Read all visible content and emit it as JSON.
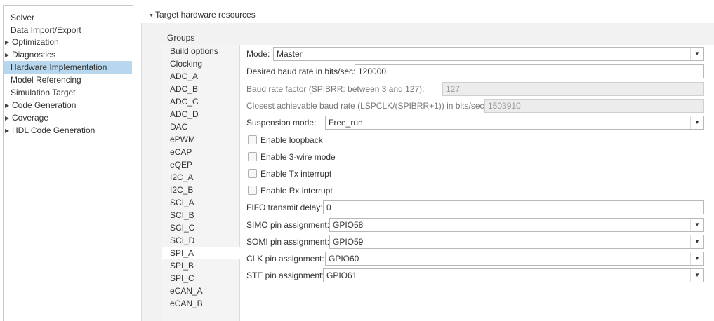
{
  "nav": {
    "items": [
      {
        "label": "Solver",
        "expandable": false
      },
      {
        "label": "Data Import/Export",
        "expandable": false
      },
      {
        "label": "Optimization",
        "expandable": true
      },
      {
        "label": "Diagnostics",
        "expandable": true
      },
      {
        "label": "Hardware Implementation",
        "expandable": false,
        "selected": true
      },
      {
        "label": "Model Referencing",
        "expandable": false
      },
      {
        "label": "Simulation Target",
        "expandable": false
      },
      {
        "label": "Code Generation",
        "expandable": true
      },
      {
        "label": "Coverage",
        "expandable": true
      },
      {
        "label": "HDL Code Generation",
        "expandable": true
      }
    ]
  },
  "section": {
    "title": "Target hardware resources",
    "expanded_icon": "triangle-down-icon"
  },
  "groups": {
    "title": "Groups",
    "items": [
      "Build options",
      "Clocking",
      "ADC_A",
      "ADC_B",
      "ADC_C",
      "ADC_D",
      "DAC",
      "ePWM",
      "eCAP",
      "eQEP",
      "I2C_A",
      "I2C_B",
      "SCI_A",
      "SCI_B",
      "SCI_C",
      "SCI_D",
      "SPI_A",
      "SPI_B",
      "SPI_C",
      "eCAN_A",
      "eCAN_B"
    ],
    "selected": "SPI_A"
  },
  "params": {
    "mode": {
      "label": "Mode:",
      "value": "Master"
    },
    "baud_rate": {
      "label": "Desired baud rate in bits/sec:",
      "value": "120000"
    },
    "baud_factor": {
      "label": "Baud rate factor (SPIBRR: between 3 and 127):",
      "value": "127"
    },
    "closest_baud": {
      "label": "Closest achievable baud rate (LSPCLK/(SPIBRR+1)) in bits/sec:",
      "value": "1503910"
    },
    "suspension": {
      "label": "Suspension mode:",
      "value": "Free_run"
    },
    "checkboxes": [
      {
        "label": "Enable loopback",
        "checked": false
      },
      {
        "label": "Enable 3-wire mode",
        "checked": false
      },
      {
        "label": "Enable Tx interrupt",
        "checked": false
      },
      {
        "label": "Enable Rx interrupt",
        "checked": false
      }
    ],
    "fifo_delay": {
      "label": "FIFO transmit delay:",
      "value": "0"
    },
    "simo": {
      "label": "SIMO pin assignment:",
      "value": "GPIO58"
    },
    "somi": {
      "label": "SOMI pin assignment:",
      "value": "GPIO59"
    },
    "clk": {
      "label": "CLK pin assignment:",
      "value": "GPIO60"
    },
    "ste": {
      "label": "STE pin assignment:",
      "value": "GPIO61"
    }
  },
  "colors": {
    "selection": "#b7d7ee",
    "panel_bg": "#f2f2f2",
    "readonly_bg": "#ececec"
  }
}
